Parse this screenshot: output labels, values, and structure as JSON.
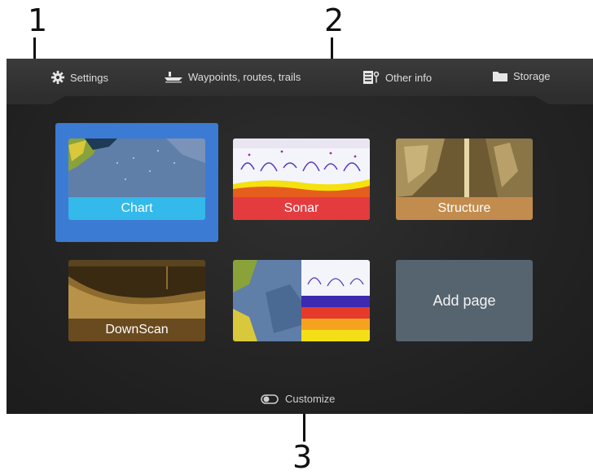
{
  "callouts": {
    "c1": "1",
    "c2": "2",
    "c3": "3"
  },
  "topbar": {
    "settings": {
      "label": "Settings",
      "icon": "gear-icon"
    },
    "waypoints": {
      "label": "Waypoints, routes, trails",
      "icon": "boat-icon"
    },
    "other_info": {
      "label": "Other info",
      "icon": "info-panel-icon"
    },
    "storage": {
      "label": "Storage",
      "icon": "folder-icon"
    }
  },
  "tiles": {
    "chart": {
      "label": "Chart",
      "color": "#33b9ea",
      "selected": true
    },
    "sonar": {
      "label": "Sonar",
      "color": "#e43b3f"
    },
    "structure": {
      "label": "Structure",
      "color": "#c28c4e"
    },
    "downscan": {
      "label": "DownScan",
      "color": "#6a4a1f"
    },
    "combo": {
      "label": ""
    },
    "add_page": {
      "label": "Add page"
    }
  },
  "footer": {
    "customize": "Customize",
    "icon": "toggle-icon"
  },
  "colors": {
    "selection": "#3c7bd3",
    "screen_bg": "#262626"
  }
}
